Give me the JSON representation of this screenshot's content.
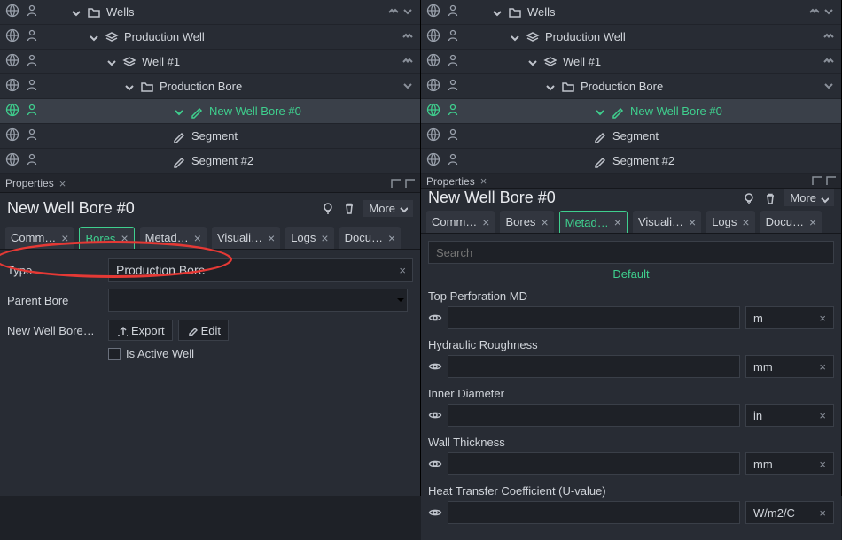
{
  "colors": {
    "accent": "#3fcf8e",
    "highlight_red": "#e53935"
  },
  "tree": {
    "items": [
      {
        "label": "Wells",
        "icon": "folder",
        "chev": "down",
        "right": [
          "up2",
          "down1"
        ]
      },
      {
        "label": "Production Well",
        "icon": "layers",
        "chev": "down",
        "right": [
          "up2"
        ]
      },
      {
        "label": "Well #1",
        "icon": "layers",
        "chev": "down",
        "right": [
          "up2"
        ]
      },
      {
        "label": "Production Bore",
        "icon": "folder",
        "chev": "down",
        "right": [
          "down1"
        ]
      },
      {
        "label": "New Well Bore #0",
        "icon": "pencil",
        "chev": "down",
        "selected": true
      },
      {
        "label": "Segment",
        "icon": "pencil"
      },
      {
        "label": "Segment #2",
        "icon": "pencil"
      }
    ]
  },
  "properties": {
    "panel_title": "Properties",
    "title": "New Well Bore #0",
    "more_label": "More",
    "tabs": [
      {
        "label": "Comm…"
      },
      {
        "label": "Bores"
      },
      {
        "label": "Metad…"
      },
      {
        "label": "Visuali…"
      },
      {
        "label": "Logs"
      },
      {
        "label": "Docu…"
      }
    ]
  },
  "left_panel": {
    "active_tab_index": 1,
    "fields": {
      "type_label": "Type",
      "type_value": "Production Bore",
      "parent_label": "Parent Bore",
      "parent_value": "",
      "row3_label": "New Well Bore…",
      "export_label": "Export",
      "edit_label": "Edit",
      "checkbox_label": "Is Active Well"
    }
  },
  "right_panel": {
    "active_tab_index": 2,
    "search_placeholder": "Search",
    "default_label": "Default",
    "fields": [
      {
        "label": "Top Perforation MD",
        "value": "",
        "unit": "m"
      },
      {
        "label": "Hydraulic Roughness",
        "value": "",
        "unit": "mm"
      },
      {
        "label": "Inner Diameter",
        "value": "",
        "unit": "in"
      },
      {
        "label": "Wall Thickness",
        "value": "",
        "unit": "mm"
      },
      {
        "label": "Heat Transfer Coefficient (U-value)",
        "value": "",
        "unit": "W/m2/C"
      }
    ]
  }
}
